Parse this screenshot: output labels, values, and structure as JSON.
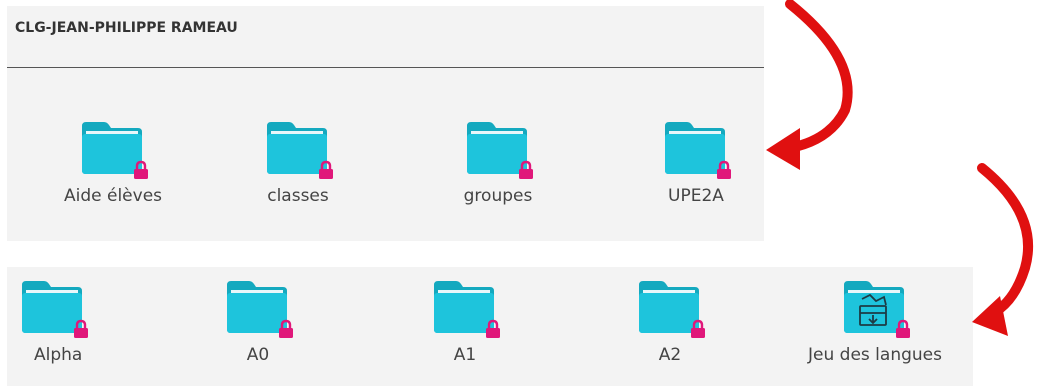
{
  "school": {
    "name": "CLG-JEAN-PHILIPPE RAMEAU"
  },
  "top_folders": [
    {
      "label": "Aide élèves",
      "icon": "folder-lock-icon"
    },
    {
      "label": "classes",
      "icon": "folder-lock-icon"
    },
    {
      "label": "groupes",
      "icon": "folder-lock-icon"
    },
    {
      "label": "UPE2A",
      "icon": "folder-lock-icon"
    }
  ],
  "sub_folders": [
    {
      "label": "Alpha",
      "icon": "folder-lock-icon"
    },
    {
      "label": "A0",
      "icon": "folder-lock-icon"
    },
    {
      "label": "A1",
      "icon": "folder-lock-icon"
    },
    {
      "label": "A2",
      "icon": "folder-lock-icon"
    },
    {
      "label": "Jeu des langues",
      "icon": "game-folder-lock-icon"
    }
  ],
  "colors": {
    "folder": "#1ec4dc",
    "folder_tab": "#14a9bf",
    "lock": "#e0177a",
    "arrow": "#e01010",
    "panel": "#f3f3f3"
  }
}
